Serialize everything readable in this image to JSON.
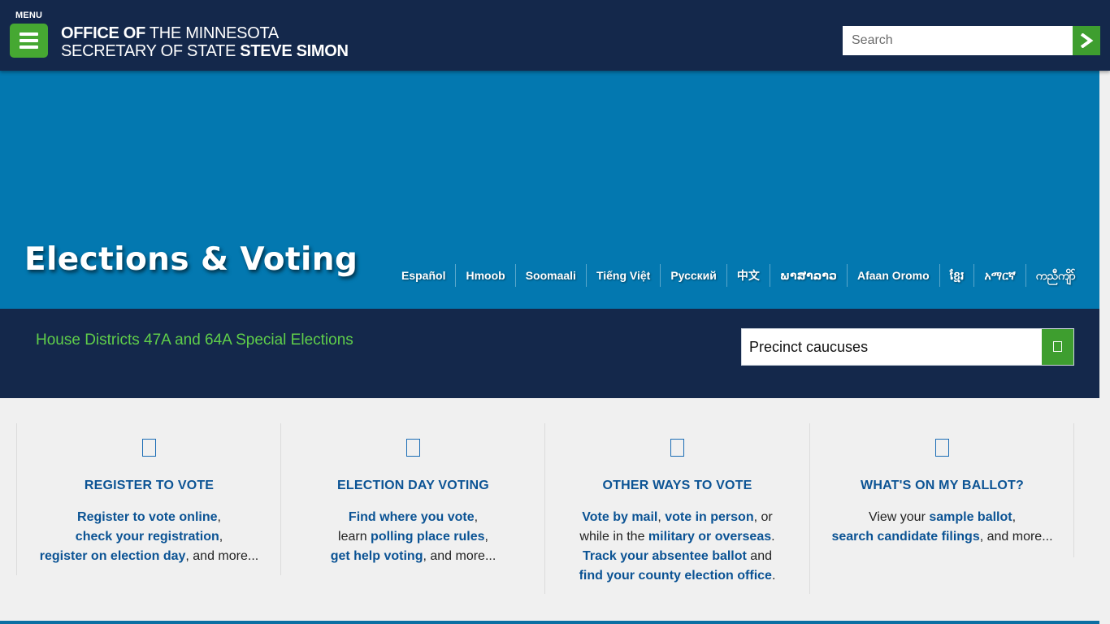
{
  "header": {
    "menu_label": "MENU",
    "brand_line1_bold": "OFFICE OF",
    "brand_line1_rest": " THE MINNESOTA",
    "brand_line2_rest": "SECRETARY OF STATE ",
    "brand_line2_bold": "STEVE SIMON",
    "search_placeholder": "Search"
  },
  "hero": {
    "title": "Elections & Voting",
    "languages": [
      "Español",
      "Hmoob",
      "Soomaali",
      "Tiếng Việt",
      "Русский",
      "中文",
      "ພາສາລາວ",
      "Afaan Oromo",
      "ខ្មែរ",
      "አማርኛ",
      "ကညီကျိာ်"
    ]
  },
  "band": {
    "link": "House Districts 47A and 64A Special Elections",
    "select_value": "Precinct caucuses"
  },
  "cards": [
    {
      "title": "REGISTER TO VOTE",
      "l1": "Register to vote online",
      "l1_after": ",",
      "l2": "check your registration",
      "l2_after": ",",
      "l3": "register on election day",
      "l3_after": ", and more..."
    },
    {
      "title": "ELECTION DAY VOTING",
      "l1": "Find where you vote",
      "l1_after": ",",
      "l2_before": "learn ",
      "l2": "polling place rules",
      "l2_after": ",",
      "l3": "get help voting",
      "l3_after": ", and more..."
    },
    {
      "title": "OTHER WAYS TO VOTE",
      "l1a": "Vote by mail",
      "l1_sep": ", ",
      "l1b": "vote in person",
      "l1_after": ", or",
      "l2_before": "while in the ",
      "l2": "military or overseas",
      "l2_after": ".",
      "l3": "Track your absentee ballot",
      "l3_after": " and",
      "l4": "find your county election office",
      "l4_after": "."
    },
    {
      "title": "WHAT'S ON MY BALLOT?",
      "l1_before": "View your ",
      "l1": "sample ballot",
      "l1_after": ",",
      "l2": "search candidate filings",
      "l2_after": ", and more..."
    }
  ],
  "colors": {
    "navy": "#14284b",
    "hero_blue": "#0378b0",
    "green": "#46a832",
    "link_blue": "#0b5394",
    "band_link_green": "#5fce4a"
  },
  "icons": [
    "menu-icon",
    "arrow-right-icon",
    "register-icon",
    "election-day-icon",
    "other-ways-icon",
    "ballot-icon"
  ]
}
